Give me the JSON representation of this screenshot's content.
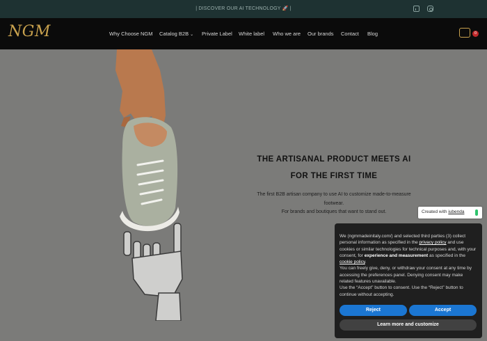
{
  "topbar": {
    "promo": "| DISCOVER OUR AI TECHNOLOGY 🚀 |",
    "social": [
      "linkedin-icon",
      "instagram-icon"
    ]
  },
  "header": {
    "logo": "NGM",
    "nav": [
      {
        "label": "Why Choose NGM"
      },
      {
        "label": "Catalog B2B",
        "dropdown": true
      },
      {
        "label": "Private Label"
      },
      {
        "label": "White label"
      },
      {
        "label": "Who we are"
      },
      {
        "label": "Our brands"
      },
      {
        "label": "Contact"
      },
      {
        "label": "Blog"
      }
    ],
    "cart_count": "0"
  },
  "hero": {
    "headline_1": "THE ARTISANAL PRODUCT MEETS AI",
    "headline_2": "FOR THE FIRST TIME",
    "sub_1": "The first B2B artisan company to use AI to customize made-to-measure footwear.",
    "sub_2": "For brands and boutiques that want to stand out."
  },
  "iubenda": {
    "prefix": "Created with ",
    "brand": "iubenda"
  },
  "cookie_banner": {
    "p1_a": "We (ngmmadeinitaly.com/) and selected third parties (3) collect personal information as specified in the ",
    "p1_link1": "privacy policy",
    "p1_b": " and use cookies or similar technologies for technical purposes and, with your consent, for ",
    "p1_bold": "experience and measurement",
    "p1_c": " as specified in the ",
    "p1_link2": "cookie policy",
    "p1_d": ".",
    "p2": "You can freely give, deny, or withdraw your consent at any time by accessing the preferences panel. Denying consent may make related features unavailable.",
    "p3": "Use the “Accept” button to consent. Use the “Reject” button to continue without accepting.",
    "reject": "Reject",
    "accept": "Accept",
    "more": "Learn more and customize"
  },
  "colors": {
    "topbar": "#1e3232",
    "header": "#0b0b0b",
    "gold": "#c9a24e",
    "hero_bg": "#7b7b79",
    "button_blue": "#1b76d2",
    "banner_bg": "#1f1f1f"
  }
}
